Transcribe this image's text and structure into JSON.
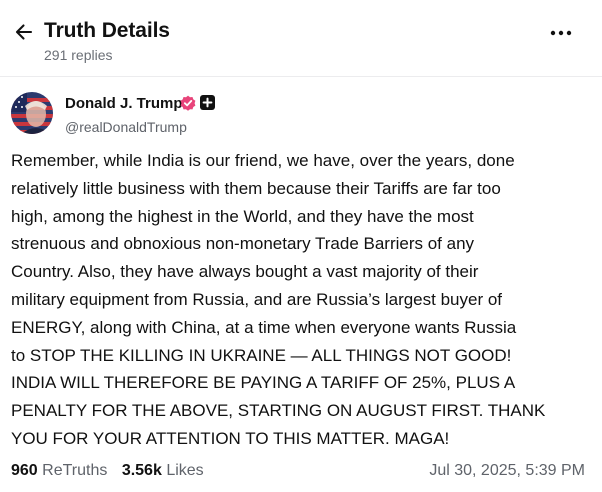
{
  "header": {
    "title": "Truth Details",
    "replies": "291 replies"
  },
  "author": {
    "name": "Donald J. Trump",
    "handle": "@realDonaldTrump",
    "verified_color": "#e8447a"
  },
  "post": {
    "lines": [
      "Remember, while India is our friend, we have, over the years, done",
      "relatively little business with them because their Tariffs are far too",
      "high, among the highest in the World, and they have the most",
      "strenuous and obnoxious non-monetary Trade Barriers of any",
      "Country. Also, they have always bought a vast majority of their",
      "military equipment from Russia, and are Russia’s largest buyer of",
      "ENERGY, along with China, at a time when everyone wants Russia",
      "to STOP THE KILLING IN UKRAINE — ALL THINGS NOT GOOD!",
      "INDIA WILL THEREFORE BE PAYING A TARIFF OF 25%, PLUS A",
      "PENALTY FOR THE ABOVE, STARTING ON AUGUST FIRST. THANK",
      "YOU FOR YOUR ATTENTION TO THIS MATTER. MAGA!"
    ]
  },
  "stats": {
    "retruths_count": "960",
    "retruths_label": "ReTruths",
    "likes_count": "3.56k",
    "likes_label": "Likes"
  },
  "timestamp": "Jul 30, 2025, 5:39 PM",
  "icons": {
    "back": "arrow-left-icon",
    "more": "more-horizontal-icon",
    "verified": "verified-badge-icon",
    "plus": "plus-badge-icon"
  }
}
